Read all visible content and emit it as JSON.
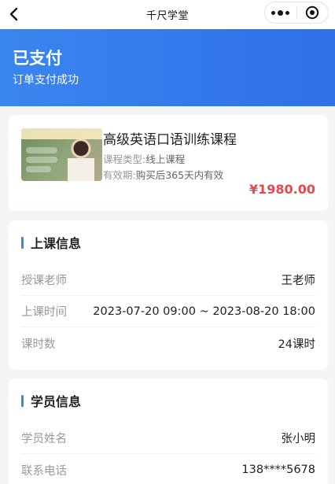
{
  "navbar": {
    "title": "千尺学堂",
    "back_icon": "chevron-left-icon",
    "menu_icon": "more-dots-icon",
    "close_icon": "target-close-icon"
  },
  "hero": {
    "status_title": "已支付",
    "status_sub": "订单支付成功",
    "bg_color": "#3a86f0"
  },
  "course": {
    "name": "高级英语口语训练课程",
    "type_label": "课程类型:",
    "type_value": "线上课程",
    "valid_label": "有效期:",
    "valid_value": "购买后365天内有效",
    "price": "¥1980.00",
    "price_color": "#e8474c"
  },
  "class_info": {
    "title": "上课信息",
    "rows": [
      {
        "label": "授课老师",
        "value": "王老师"
      },
      {
        "label": "上课时间",
        "value": "2023-07-20 09:00 ~ 2023-08-20 18:00"
      },
      {
        "label": "课时数",
        "value": "24课时"
      }
    ]
  },
  "student_info": {
    "title": "学员信息",
    "rows": [
      {
        "label": "学员姓名",
        "value": "张小明"
      },
      {
        "label": "联系电话",
        "value": "138****5678"
      }
    ]
  },
  "accent_color": "#3a86f0"
}
